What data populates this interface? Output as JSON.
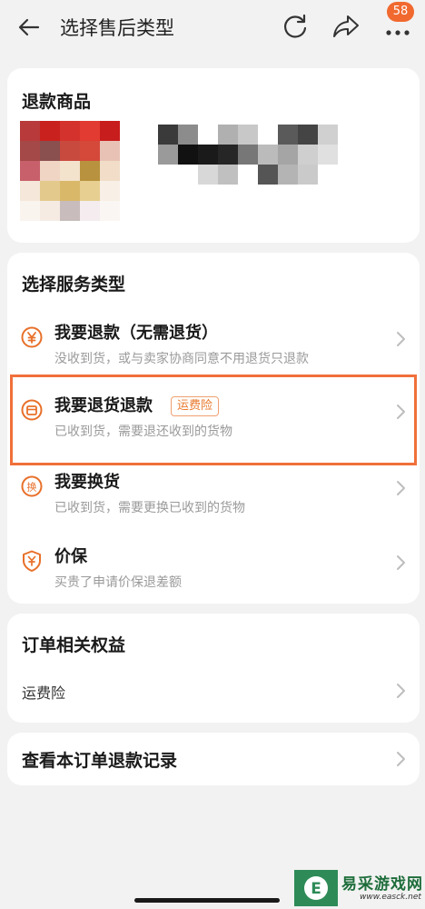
{
  "nav": {
    "title": "选择售后类型",
    "badge": "58"
  },
  "goods": {
    "title": "退款商品"
  },
  "service": {
    "title": "选择服务类型",
    "items": [
      {
        "name": "我要退款（无需退货）",
        "desc": "没收到货，或与卖家协商同意不用退货只退款",
        "icon": "refund-yen-icon"
      },
      {
        "name": "我要退货退款",
        "tag": "运费险",
        "desc": "已收到货，需要退还收到的货物",
        "icon": "return-box-icon"
      },
      {
        "name": "我要换货",
        "desc": "已收到货，需要更换已收到的货物",
        "icon": "exchange-icon"
      },
      {
        "name": "价保",
        "desc": "买贵了申请价保退差额",
        "icon": "price-protect-shield-icon"
      }
    ]
  },
  "rights": {
    "title": "订单相关权益",
    "items": [
      {
        "label": "运费险"
      }
    ]
  },
  "record": {
    "title": "查看本订单退款记录"
  },
  "watermark": {
    "name": "易采游戏网",
    "url": "www.easck.net",
    "icon_char": "E"
  },
  "colors": {
    "accent": "#f1692f",
    "highlight_border": "#f0703a",
    "tag_text": "#e8792d",
    "desc_text": "#9a9a9a"
  }
}
